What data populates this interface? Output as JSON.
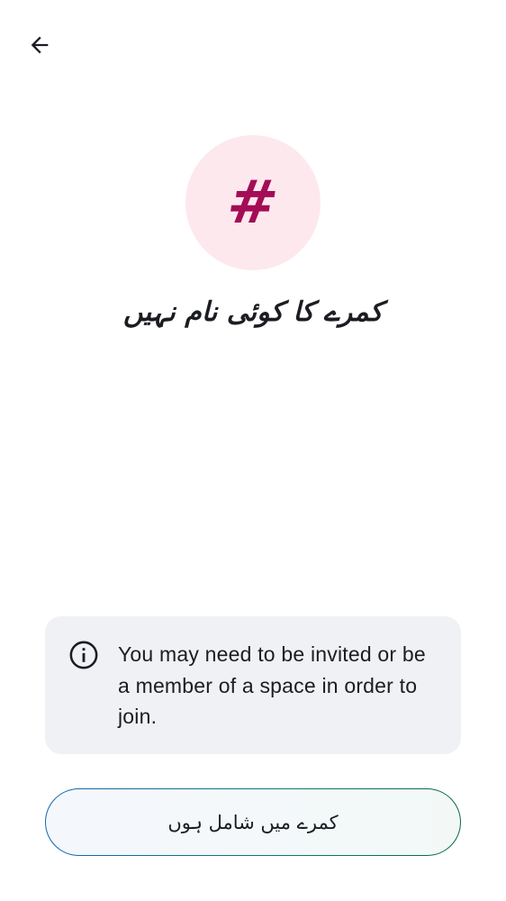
{
  "header": {
    "back_icon": "arrow-left-icon"
  },
  "room": {
    "avatar_glyph": "#",
    "avatar_bg_color": "#fde8ee",
    "avatar_glyph_color": "#a30d55",
    "title": "کمرے کا کوئی نام نہیں"
  },
  "info": {
    "icon": "info-icon",
    "message": "You may need to be invited or be a member of a space in order to join."
  },
  "actions": {
    "join_label": "کمرے میں شامل ہوں",
    "border_gradient": [
      "#1566b3",
      "#0a6b45"
    ]
  }
}
